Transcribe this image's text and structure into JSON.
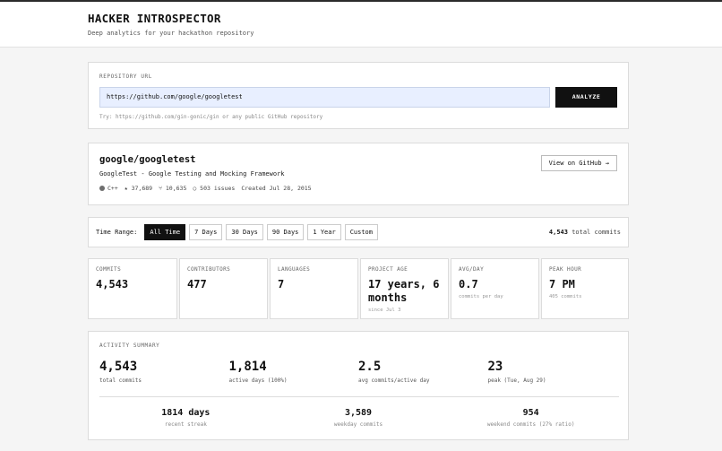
{
  "header": {
    "title": "HACKER INTROSPECTOR",
    "subtitle": "Deep analytics for your hackathon repository"
  },
  "repo_form": {
    "label": "REPOSITORY URL",
    "url_value": "https://github.com/google/googletest",
    "analyze_label": "ANALYZE",
    "hint": "Try: https://github.com/gin-gonic/gin or any public GitHub repository"
  },
  "repo": {
    "name": "google/googletest",
    "description": "GoogleTest - Google Testing and Mocking Framework",
    "language": "C++",
    "stars": "★ 37,689",
    "forks": "⑂ 10,635",
    "issues": "○ 503 issues",
    "created": "Created Jul 28, 2015",
    "view_label": "View on GitHub →"
  },
  "time_range": {
    "label": "Time Range:",
    "options": [
      "All Time",
      "7 Days",
      "30 Days",
      "90 Days",
      "1 Year",
      "Custom"
    ],
    "selected": "All Time",
    "total_value": "4,543",
    "total_suffix": "total commits"
  },
  "stats": [
    {
      "label": "COMMITS",
      "value": "4,543",
      "sub": ""
    },
    {
      "label": "CONTRIBUTORS",
      "value": "477",
      "sub": ""
    },
    {
      "label": "LANGUAGES",
      "value": "7",
      "sub": ""
    },
    {
      "label": "PROJECT AGE",
      "value": "17 years, 6 months",
      "sub": "since Jul 3"
    },
    {
      "label": "AVG/DAY",
      "value": "0.7",
      "sub": "commits per day"
    },
    {
      "label": "PEAK HOUR",
      "value": "7 PM",
      "sub": "405 commits"
    }
  ],
  "activity": {
    "title": "ACTIVITY SUMMARY",
    "top": [
      {
        "value": "4,543",
        "label": "total commits"
      },
      {
        "value": "1,814",
        "label": "active days (100%)"
      },
      {
        "value": "2.5",
        "label": "avg commits/active day"
      },
      {
        "value": "23",
        "label": "peak (Tue, Aug 29)"
      }
    ],
    "bottom": [
      {
        "value": "1814 days",
        "label": "recent streak"
      },
      {
        "value": "3,589",
        "label": "weekday commits"
      },
      {
        "value": "954",
        "label": "weekend commits (27% ratio)"
      }
    ]
  }
}
